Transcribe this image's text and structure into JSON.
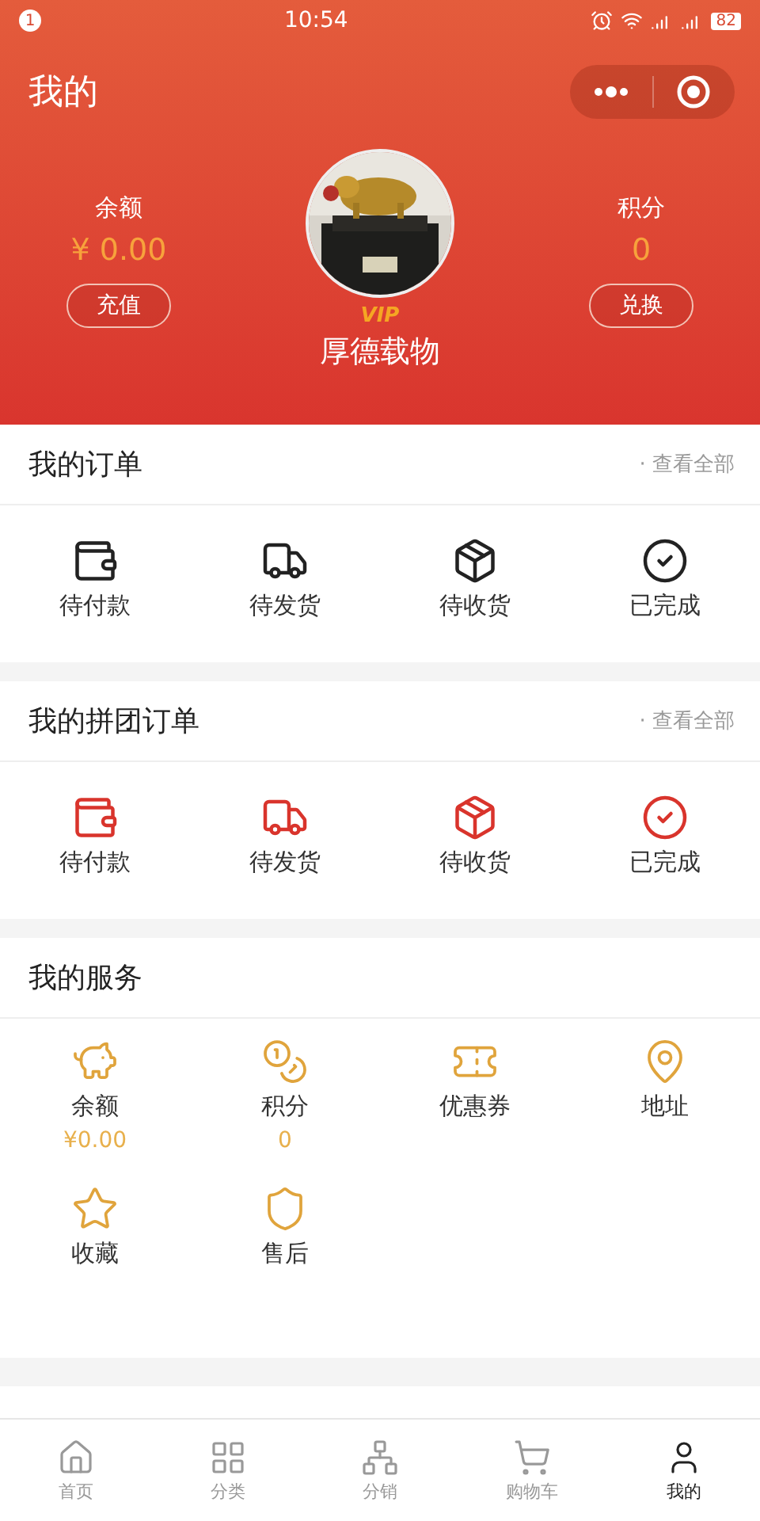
{
  "status_bar": {
    "notification_count": "1",
    "time": "10:54",
    "battery": "82"
  },
  "header": {
    "title": "我的"
  },
  "profile": {
    "balance": {
      "label": "余额",
      "value": "¥ 0.00",
      "button": "充值"
    },
    "points": {
      "label": "积分",
      "value": "0",
      "button": "兑换"
    },
    "badge": "VIP",
    "name": "厚德载物"
  },
  "sections": [
    {
      "title": "我的订单",
      "link": "· 查看全部",
      "kind": "standard",
      "items": [
        {
          "label": "待付款"
        },
        {
          "label": "待发货"
        },
        {
          "label": "待收货"
        },
        {
          "label": "已完成"
        }
      ]
    },
    {
      "title": "我的拼团订单",
      "link": "· 查看全部",
      "kind": "group",
      "items": [
        {
          "label": "待付款"
        },
        {
          "label": "待发货"
        },
        {
          "label": "待收货"
        },
        {
          "label": "已完成"
        }
      ]
    }
  ],
  "services": {
    "title": "我的服务",
    "items": [
      {
        "label": "余额",
        "value": "¥0.00"
      },
      {
        "label": "积分",
        "value": "0"
      },
      {
        "label": "优惠券"
      },
      {
        "label": "地址"
      },
      {
        "label": "收藏"
      },
      {
        "label": "售后"
      }
    ]
  },
  "tab_bar": [
    {
      "label": "首页",
      "selected": false
    },
    {
      "label": "分类",
      "selected": false
    },
    {
      "label": "分销",
      "selected": false
    },
    {
      "label": "购物车",
      "selected": false
    },
    {
      "label": "我的",
      "selected": true
    }
  ]
}
